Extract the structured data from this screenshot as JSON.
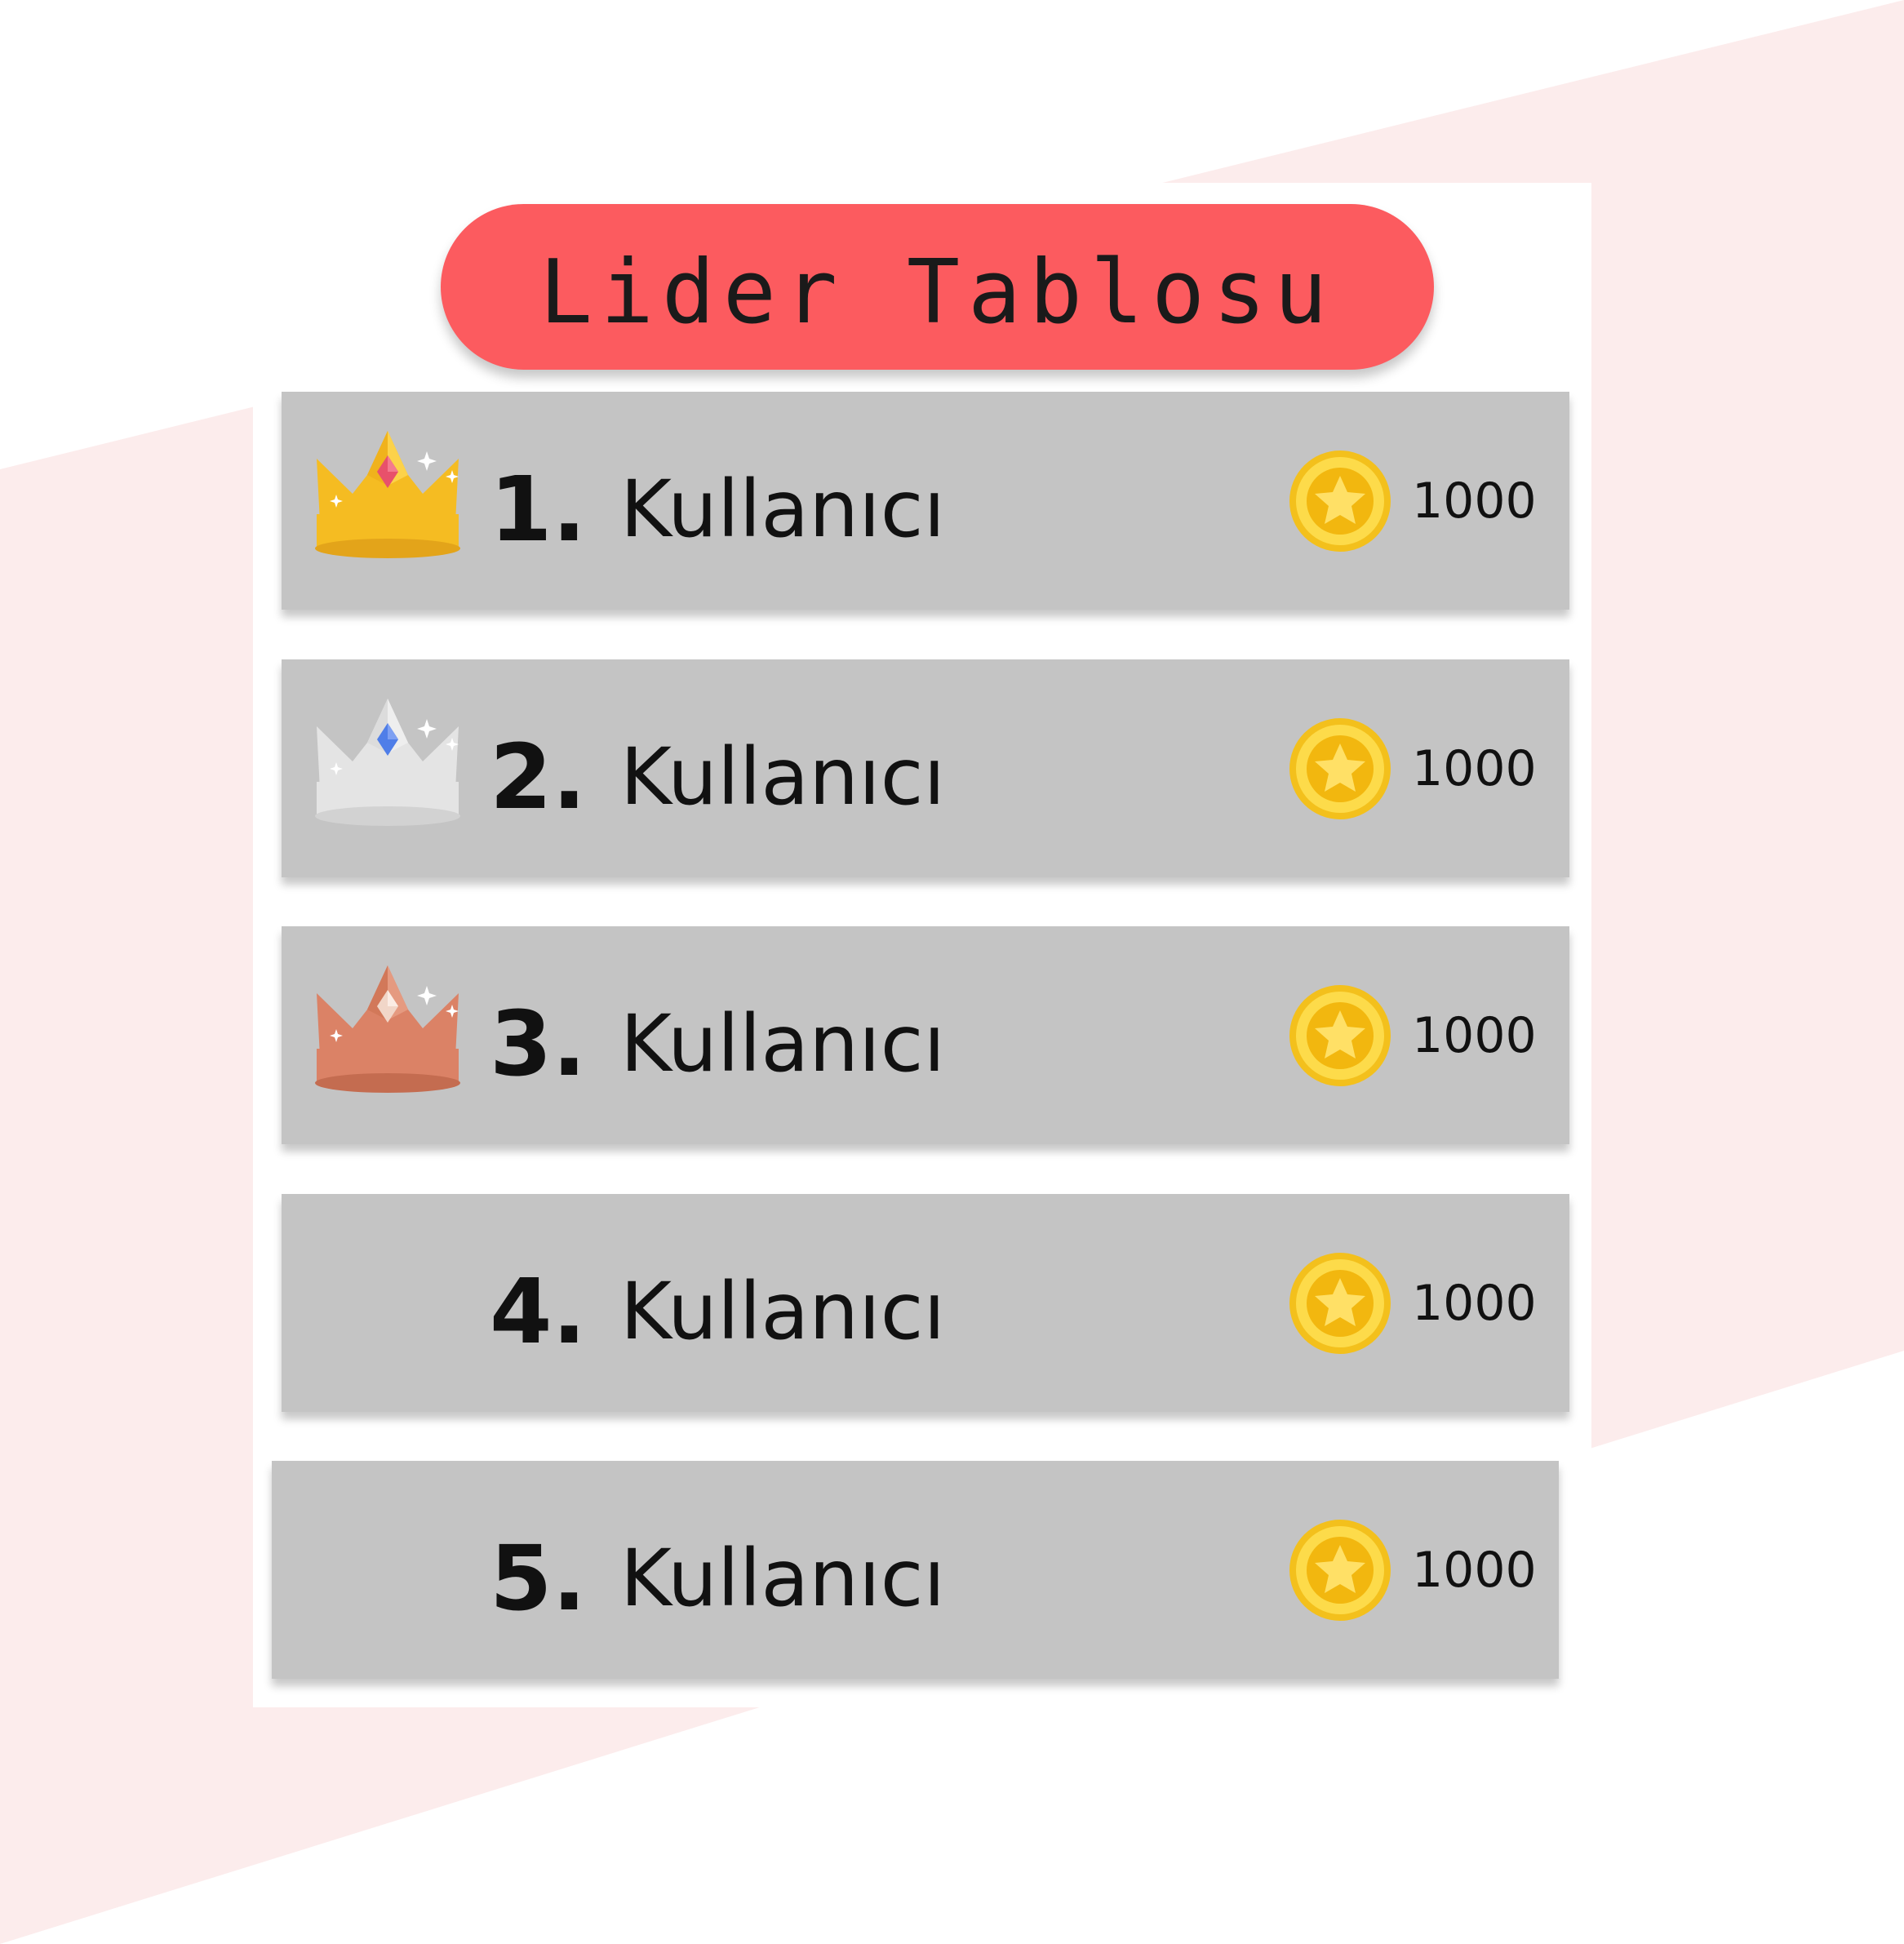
{
  "title": "Lider Tablosu",
  "colors": {
    "accent": "#fc5b5f",
    "row_bg": "#c4c4c4",
    "stripe": "#fcecec",
    "gold": "#f5bc22",
    "silver": "#e4e4e4",
    "bronze": "#db8266"
  },
  "entries": [
    {
      "rank": "1.",
      "name": "Kullanıcı",
      "score": "1000",
      "icon": "gold-crown-icon"
    },
    {
      "rank": "2.",
      "name": "Kullanıcı",
      "score": "1000",
      "icon": "silver-crown-icon"
    },
    {
      "rank": "3.",
      "name": "Kullanıcı",
      "score": "1000",
      "icon": "bronze-crown-icon"
    },
    {
      "rank": "4.",
      "name": "Kullanıcı",
      "score": "1000"
    },
    {
      "rank": "5.",
      "name": "Kullanıcı",
      "score": "1000"
    }
  ]
}
